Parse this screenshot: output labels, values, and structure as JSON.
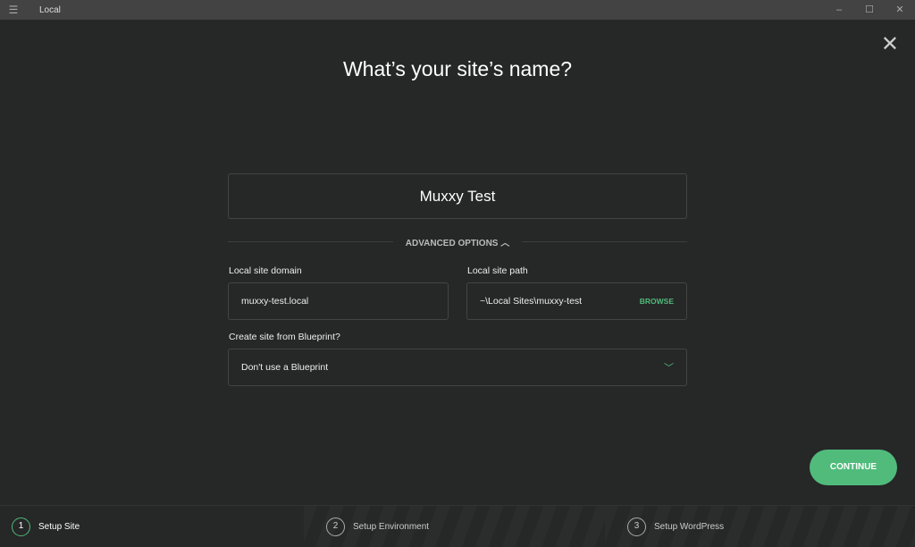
{
  "window": {
    "title": "Local",
    "menu_icon": "hamburger-icon",
    "minimize": "–",
    "maximize": "☐",
    "close": "✕"
  },
  "heading": "What’s your site’s name?",
  "site_name": "Muxxy Test",
  "advanced_options": "ADVANCED OPTIONS ︿",
  "domain": {
    "label": "Local site domain",
    "value": "muxxy-test.local"
  },
  "path": {
    "label": "Local site path",
    "value": "~\\Local Sites\\muxxy-test",
    "browse": "BROWSE"
  },
  "blueprint": {
    "label": "Create site from Blueprint?",
    "value": "Don't use a Blueprint",
    "chevron": "﹀"
  },
  "continue": "CONTINUE",
  "close_icon": "✕",
  "steps": [
    {
      "num": "1",
      "label": "Setup Site"
    },
    {
      "num": "2",
      "label": "Setup Environment"
    },
    {
      "num": "3",
      "label": "Setup WordPress"
    }
  ],
  "accent": "#51bb7b"
}
